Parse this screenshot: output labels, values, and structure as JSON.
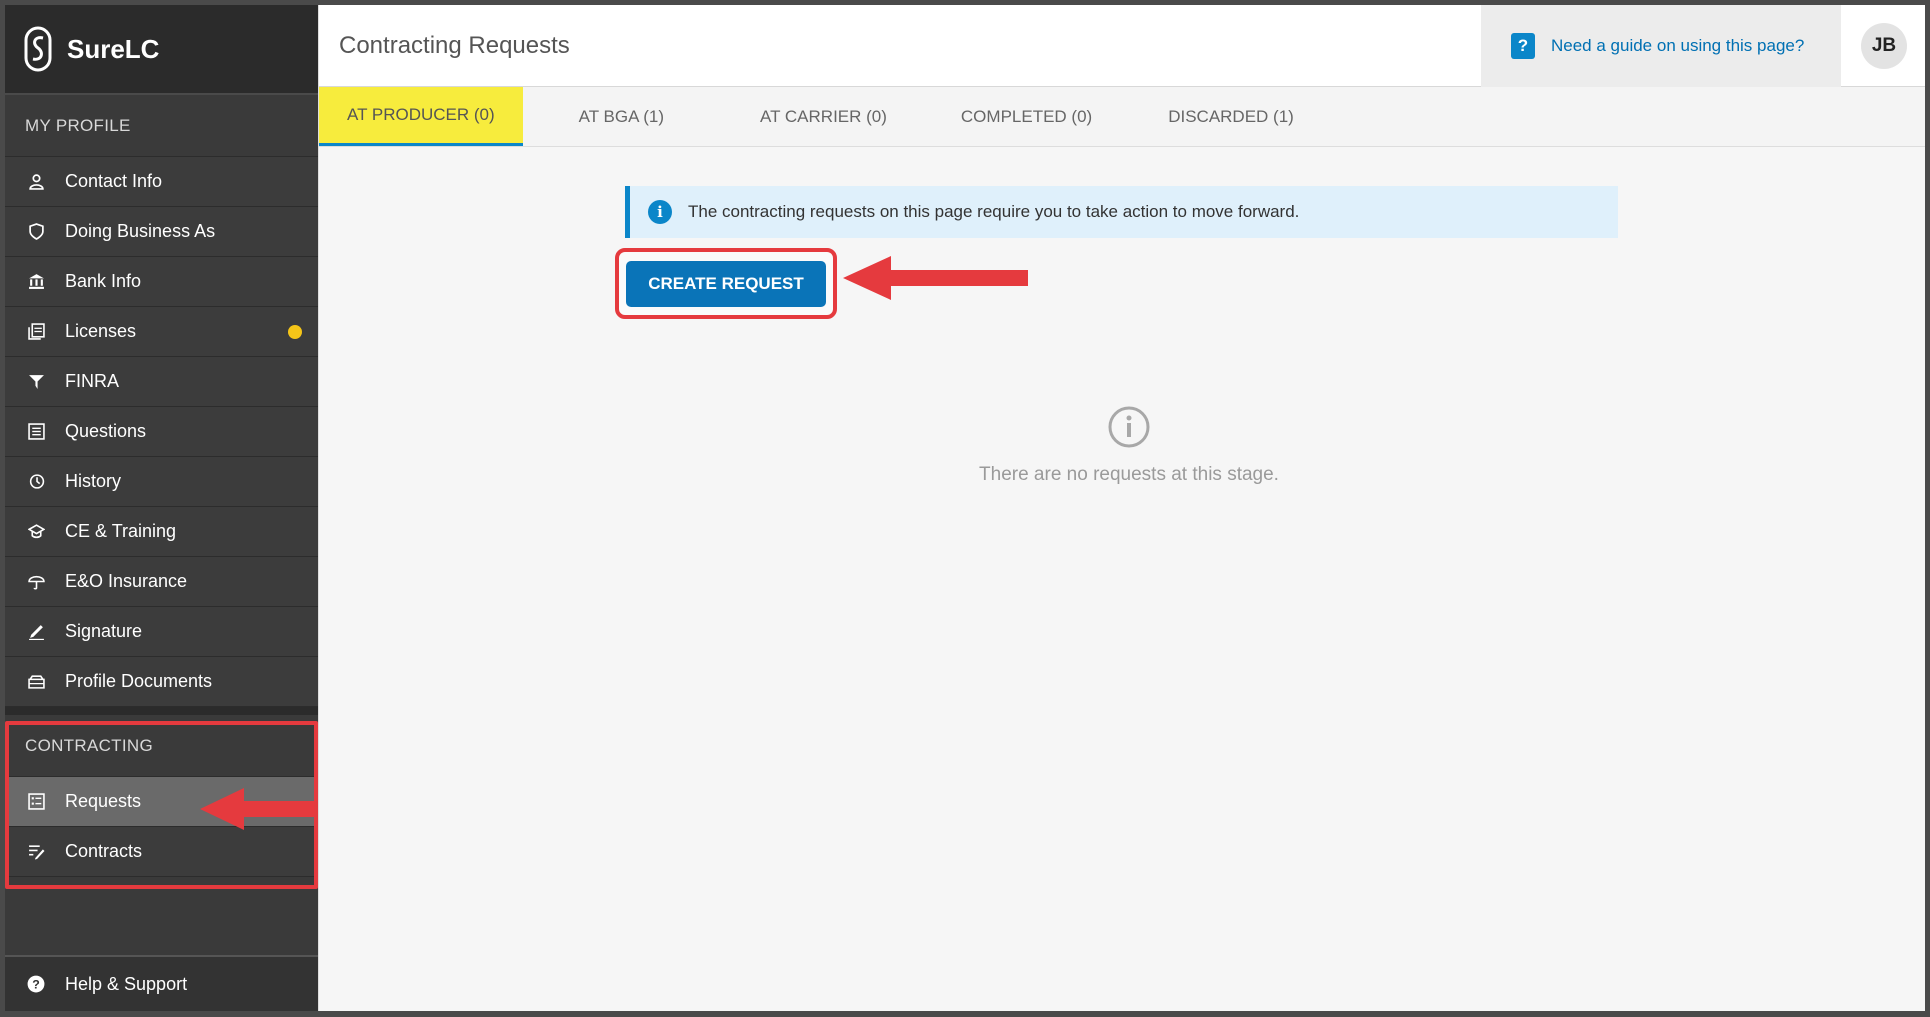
{
  "app": {
    "name": "SureLC",
    "user_initials": "JB"
  },
  "sidebar": {
    "profile_header": "MY PROFILE",
    "profile_items": [
      {
        "label": "Contact Info",
        "icon": "person-icon"
      },
      {
        "label": "Doing Business As",
        "icon": "shield-icon"
      },
      {
        "label": "Bank Info",
        "icon": "bank-icon"
      },
      {
        "label": "Licenses",
        "icon": "license-icon",
        "badge": "warning-dot"
      },
      {
        "label": "FINRA",
        "icon": "finra-icon"
      },
      {
        "label": "Questions",
        "icon": "list-icon"
      },
      {
        "label": "History",
        "icon": "history-icon"
      },
      {
        "label": "CE & Training",
        "icon": "graduation-cap-icon"
      },
      {
        "label": "E&O Insurance",
        "icon": "umbrella-icon"
      },
      {
        "label": "Signature",
        "icon": "pen-icon"
      },
      {
        "label": "Profile Documents",
        "icon": "documents-icon"
      }
    ],
    "contracting_header": "CONTRACTING",
    "contracting_items": [
      {
        "label": "Requests",
        "icon": "requests-icon",
        "active": true
      },
      {
        "label": "Contracts",
        "icon": "contracts-icon"
      }
    ],
    "help_label": "Help & Support"
  },
  "header": {
    "title": "Contracting Requests",
    "guide_label": "Need a guide on using this page?"
  },
  "tabs": [
    {
      "label": "AT PRODUCER (0)",
      "active": true
    },
    {
      "label": "AT BGA (1)"
    },
    {
      "label": "AT CARRIER (0)"
    },
    {
      "label": "COMPLETED (0)"
    },
    {
      "label": "DISCARDED (1)"
    }
  ],
  "main": {
    "alert_text": "The contracting requests on this page require you to take action to move forward.",
    "create_button": "CREATE REQUEST",
    "empty_text": "There are no requests at this stage."
  },
  "colors": {
    "accent": "#0a74b8",
    "highlight": "#f7ec3d",
    "annotation": "#e53a3e",
    "badge": "#f5c518"
  }
}
